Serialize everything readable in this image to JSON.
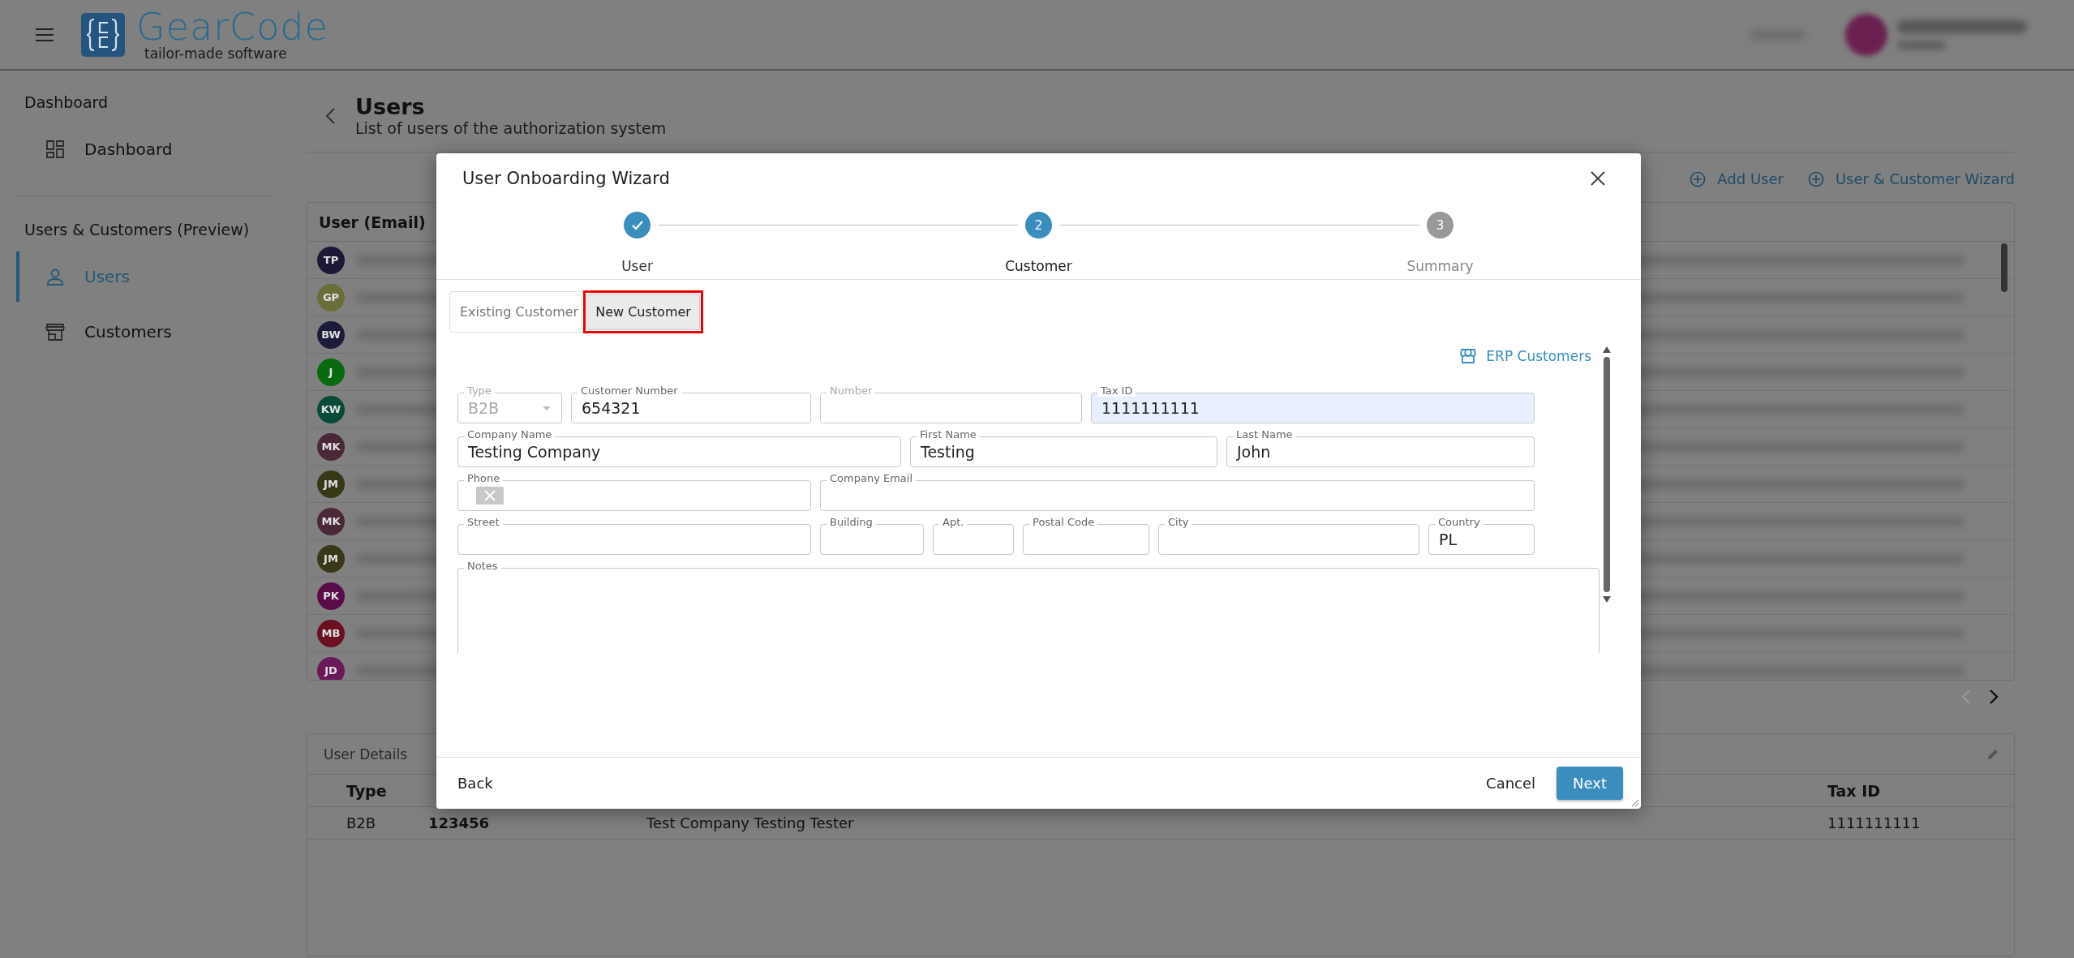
{
  "header": {
    "logo_title": "GearCode",
    "logo_tagline": "tailor-made software"
  },
  "sidebar": {
    "sections": [
      {
        "title": "Dashboard",
        "items": [
          {
            "label": "Dashboard",
            "selected": false
          }
        ]
      },
      {
        "title": "Users & Customers (Preview)",
        "items": [
          {
            "label": "Users",
            "selected": true
          },
          {
            "label": "Customers",
            "selected": false
          }
        ]
      }
    ]
  },
  "page": {
    "title": "Users",
    "subtitle": "List of users of the authorization system"
  },
  "actions": [
    {
      "label": "Add User"
    },
    {
      "label": "User & Customer Wizard"
    }
  ],
  "users_table": {
    "columns": [
      "User (Email)"
    ],
    "rows": [
      {
        "initials": "TP",
        "color": "#1c1838"
      },
      {
        "initials": "GP",
        "color": "#6b6e3a"
      },
      {
        "initials": "BW",
        "color": "#1c1c3a"
      },
      {
        "initials": "J",
        "color": "#0a6a10"
      },
      {
        "initials": "KW",
        "color": "#0a4a38"
      },
      {
        "initials": "MK",
        "color": "#4a2838"
      },
      {
        "initials": "JM",
        "color": "#383818"
      },
      {
        "initials": "MK",
        "color": "#4a2838"
      },
      {
        "initials": "JM",
        "color": "#383818"
      },
      {
        "initials": "PK",
        "color": "#5a0c48"
      },
      {
        "initials": "MB",
        "color": "#6a1020"
      },
      {
        "initials": "JD",
        "color": "#6a1858"
      }
    ]
  },
  "details": {
    "tabs": [
      {
        "label": "User Details",
        "selected": false
      }
    ],
    "columns": [
      "Type",
      null,
      null,
      "Tax ID"
    ],
    "rows": [
      [
        "B2B",
        "**123456**",
        "Test Company Testing Tester",
        "1111111111"
      ]
    ]
  },
  "dialog": {
    "title": "User Onboarding Wizard",
    "steps": [
      {
        "label": "User",
        "completed": true,
        "selected": false
      },
      {
        "label": "Customer",
        "number": "2",
        "completed": false,
        "selected": true
      },
      {
        "label": "Summary",
        "number": "3",
        "completed": false,
        "selected": false
      }
    ],
    "customer_mode": [
      {
        "label": "Existing Customer",
        "selected": false,
        "annotated": false
      },
      {
        "label": "New Customer",
        "selected": true,
        "annotated": true
      }
    ],
    "erp_link": "ERP Customers",
    "form_rows": [
      [
        {
          "label": "Type",
          "value": "B2B",
          "kind": "select",
          "disabled": true
        },
        {
          "label": "Customer Number",
          "value": "654321",
          "kind": "text"
        },
        {
          "label": "Number",
          "kind": "text",
          "disabled": true
        },
        {
          "label": "Tax ID",
          "value": "1111111111",
          "kind": "text",
          "autofilled": true
        }
      ],
      [
        {
          "label": "Company Name",
          "value": "Testing Company",
          "kind": "text"
        },
        {
          "label": "First Name",
          "value": "Testing",
          "kind": "text"
        },
        {
          "label": "Last Name",
          "value": "John",
          "kind": "text"
        }
      ],
      [
        {
          "label": "Phone",
          "kind": "phone"
        },
        {
          "label": "Company Email",
          "kind": "text"
        }
      ],
      [
        {
          "label": "Street",
          "kind": "text"
        },
        {
          "label": "Building",
          "kind": "text"
        },
        {
          "label": "Apt.",
          "kind": "text"
        },
        {
          "label": "Postal Code",
          "kind": "text"
        },
        {
          "label": "City",
          "kind": "text"
        },
        {
          "label": "Country",
          "value": "PL",
          "kind": "text"
        }
      ],
      [
        {
          "label": "Notes",
          "kind": "textarea"
        }
      ]
    ],
    "footer": {
      "back": "Back",
      "cancel": "Cancel",
      "next": "Next"
    }
  }
}
